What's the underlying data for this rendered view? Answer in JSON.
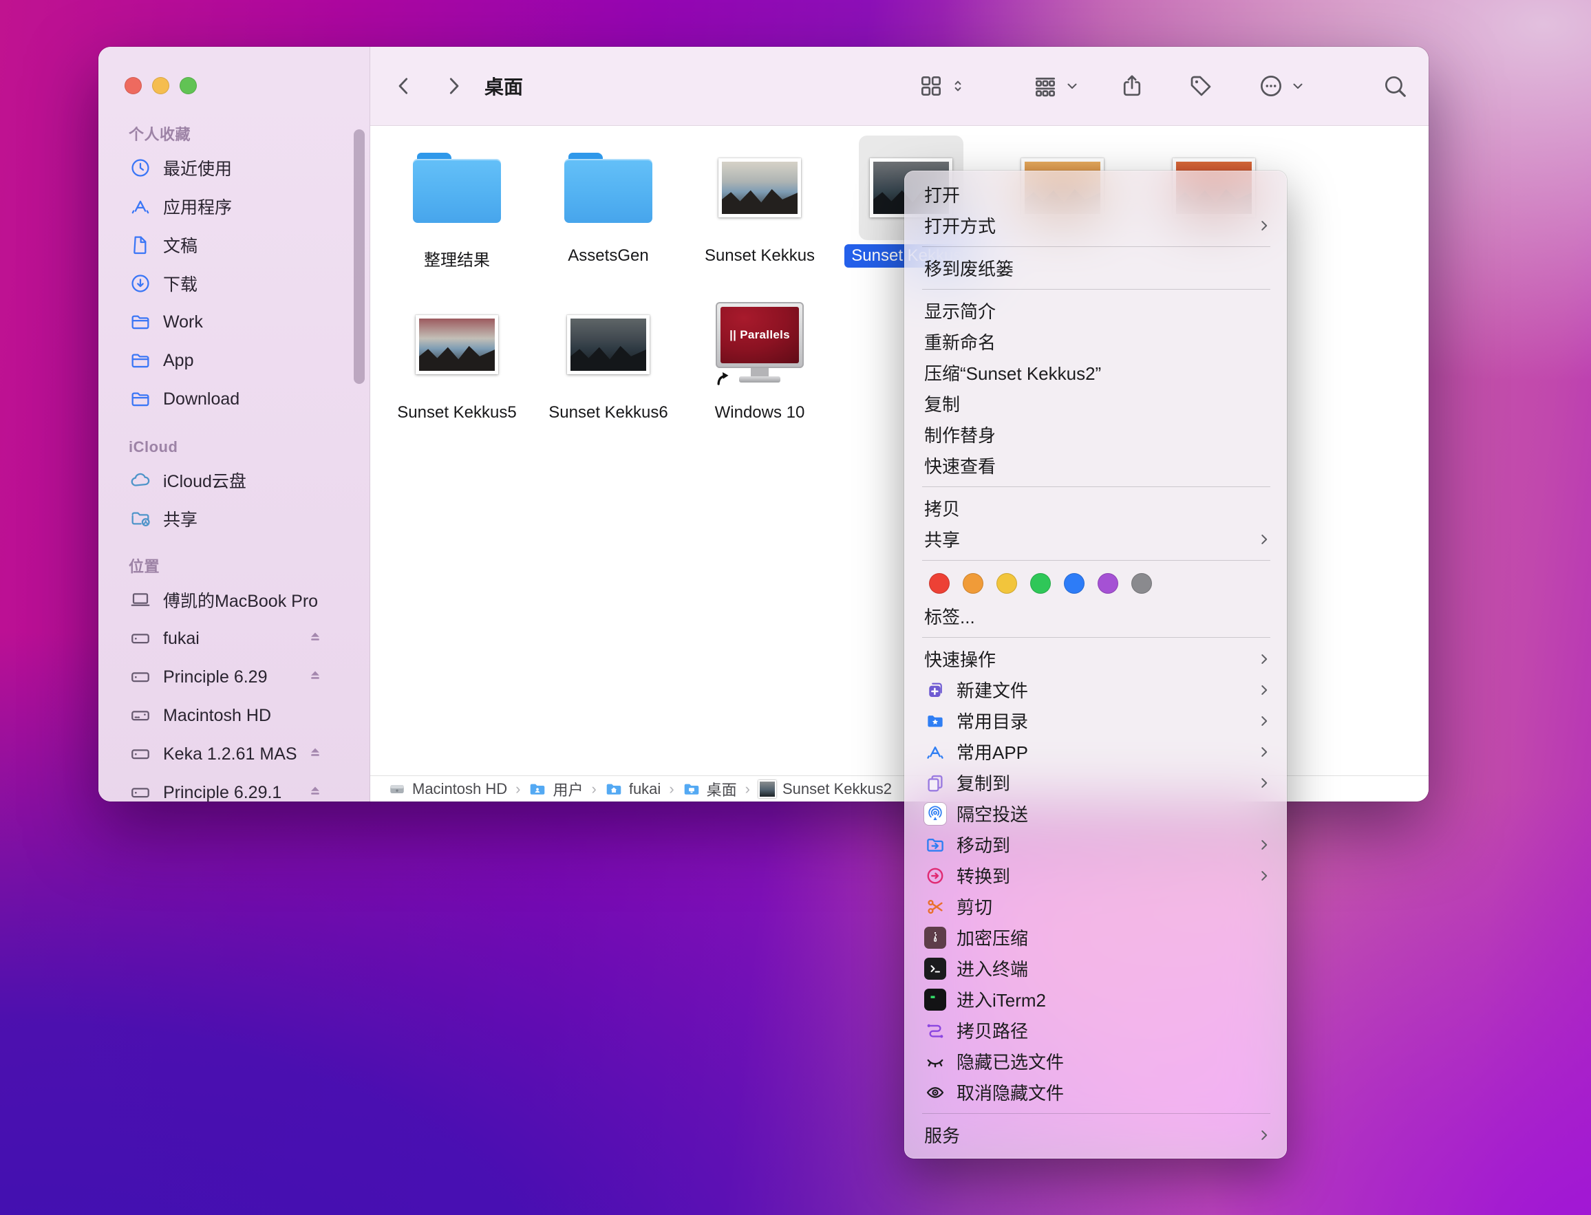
{
  "window": {
    "toolbar": {
      "title": "桌面",
      "icons": [
        {
          "name": "view-grid-icon"
        },
        {
          "name": "view-updown-icon"
        },
        {
          "name": "group-by-icon"
        },
        {
          "name": "chevron-down-icon"
        },
        {
          "name": "share-icon"
        },
        {
          "name": "tag-icon"
        },
        {
          "name": "more-icon"
        },
        {
          "name": "chevron-down-icon"
        },
        {
          "name": "search-icon"
        }
      ]
    },
    "sidebar": {
      "sections": [
        {
          "label": "个人收藏",
          "items": [
            {
              "label": "最近使用",
              "icon": "clock",
              "tint": "blue"
            },
            {
              "label": "应用程序",
              "icon": "appstore",
              "tint": "blue"
            },
            {
              "label": "文稿",
              "icon": "document",
              "tint": "blue"
            },
            {
              "label": "下载",
              "icon": "download",
              "tint": "blue"
            },
            {
              "label": "Work",
              "icon": "folder",
              "tint": "blue"
            },
            {
              "label": "App",
              "icon": "folder",
              "tint": "blue"
            },
            {
              "label": "Download",
              "icon": "folder",
              "tint": "blue"
            }
          ]
        },
        {
          "label": "iCloud",
          "items": [
            {
              "label": "iCloud云盘",
              "icon": "cloud",
              "tint": "teal"
            },
            {
              "label": "共享",
              "icon": "shared-folder",
              "tint": "teal"
            }
          ]
        },
        {
          "label": "位置",
          "items": [
            {
              "label": "傅凯的MacBook Pro",
              "icon": "laptop",
              "tint": "gray"
            },
            {
              "label": "fukai",
              "icon": "disk",
              "tint": "gray",
              "eject": true
            },
            {
              "label": "Principle 6.29",
              "icon": "disk",
              "tint": "gray",
              "eject": true
            },
            {
              "label": "Macintosh HD",
              "icon": "internal-disk",
              "tint": "gray"
            },
            {
              "label": "Keka 1.2.61 MAS",
              "icon": "disk",
              "tint": "gray",
              "eject": true
            },
            {
              "label": "Principle 6.29.1",
              "icon": "disk",
              "tint": "gray",
              "eject": true
            }
          ]
        }
      ]
    },
    "files": [
      {
        "name": "整理结果",
        "kind": "folder"
      },
      {
        "name": "AssetsGen",
        "kind": "folder"
      },
      {
        "name": "Sunset Kekkus",
        "kind": "photo",
        "variant": "mist"
      },
      {
        "name": "Sunset Kekkus2",
        "kind": "photo",
        "variant": "storm",
        "selected": true
      },
      {
        "name": "",
        "kind": "photo",
        "variant": "orange"
      },
      {
        "name": "",
        "kind": "photo",
        "variant": "red"
      },
      {
        "name": "Sunset Kekkus5",
        "kind": "photo",
        "variant": "sunset5"
      },
      {
        "name": "Sunset Kekkus6",
        "kind": "photo",
        "variant": "sunset6"
      },
      {
        "name": "Windows 10",
        "kind": "parallels",
        "screen_label": "|| Parallels"
      }
    ],
    "pathbar": [
      {
        "label": "Macintosh HD",
        "icon": "disk-mini"
      },
      {
        "label": "用户",
        "icon": "folder-users"
      },
      {
        "label": "fukai",
        "icon": "folder-home"
      },
      {
        "label": "桌面",
        "icon": "folder-desktop"
      },
      {
        "label": "Sunset Kekkus2",
        "icon": "photo-mini"
      }
    ]
  },
  "context_menu": {
    "sections": [
      {
        "items": [
          {
            "label": "打开"
          },
          {
            "label": "打开方式",
            "submenu": true
          }
        ]
      },
      {
        "items": [
          {
            "label": "移到废纸篓"
          }
        ]
      },
      {
        "items": [
          {
            "label": "显示简介"
          },
          {
            "label": "重新命名"
          },
          {
            "label": "压缩“Sunset Kekkus2”"
          },
          {
            "label": "复制"
          },
          {
            "label": "制作替身"
          },
          {
            "label": "快速查看"
          }
        ]
      },
      {
        "items": [
          {
            "label": "拷贝"
          },
          {
            "label": "共享",
            "submenu": true
          }
        ]
      },
      {
        "tags": [
          "#ed4135",
          "#f09b38",
          "#f2c53c",
          "#2fc758",
          "#2d7cf7",
          "#a551d4",
          "#8a8a8e"
        ],
        "items": [
          {
            "label": "标签..."
          }
        ]
      },
      {
        "items": [
          {
            "label": "快速操作",
            "submenu": true
          },
          {
            "label": "新建文件",
            "icon": "new-file",
            "submenu": true
          },
          {
            "label": "常用目录",
            "icon": "folder-star",
            "submenu": true
          },
          {
            "label": "常用APP",
            "icon": "appstore-blue",
            "submenu": true
          },
          {
            "label": "复制到",
            "icon": "copy-to",
            "submenu": true
          },
          {
            "label": "隔空投送",
            "icon": "airdrop"
          },
          {
            "label": "移动到",
            "icon": "move-to",
            "submenu": true
          },
          {
            "label": "转换到",
            "icon": "convert-to",
            "submenu": true
          },
          {
            "label": "剪切",
            "icon": "scissors"
          },
          {
            "label": "加密压缩",
            "icon": "zip"
          },
          {
            "label": "进入终端",
            "icon": "terminal"
          },
          {
            "label": "进入iTerm2",
            "icon": "iterm"
          },
          {
            "label": "拷贝路径",
            "icon": "copy-path"
          },
          {
            "label": "隐藏已选文件",
            "icon": "eye-closed"
          },
          {
            "label": "取消隐藏文件",
            "icon": "eye"
          }
        ]
      },
      {
        "items": [
          {
            "label": "服务",
            "submenu": true
          }
        ]
      }
    ]
  },
  "colors": {
    "selection_accent": "#2460ea",
    "folder_blue": "#53b2f2",
    "sidebar_icon_blue": "#3a76f6"
  }
}
